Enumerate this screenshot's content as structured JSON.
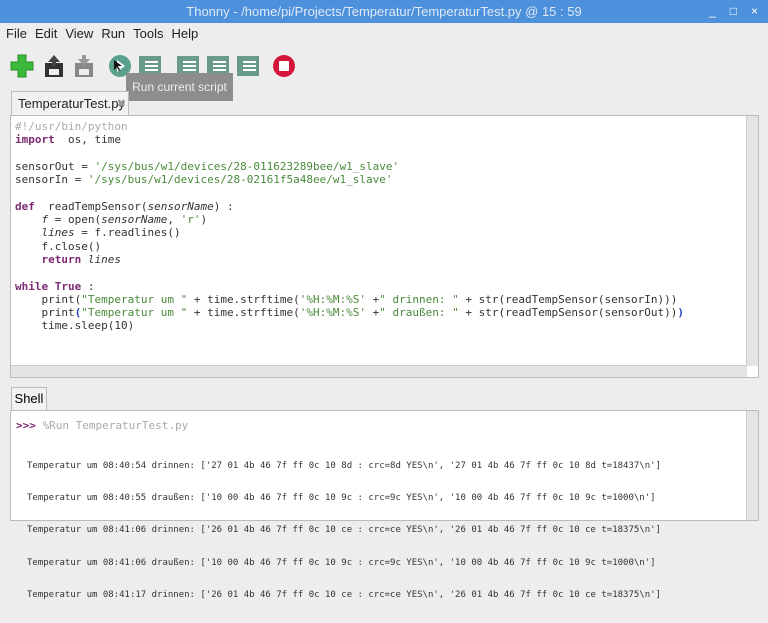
{
  "window": {
    "title": "Thonny  -  /home/pi/Projects/Temperatur/TemperaturTest.py  @  15 : 59",
    "minimize": "_",
    "maximize": "□",
    "close": "×"
  },
  "menu": [
    "File",
    "Edit",
    "View",
    "Run",
    "Tools",
    "Help"
  ],
  "toolbar": {
    "icons": [
      "new-file-icon",
      "load-icon",
      "save-icon",
      "run-icon",
      "debug-icon",
      "step-over-icon",
      "step-into-icon",
      "step-out-icon",
      "stop-icon"
    ],
    "tooltip": "Run current script",
    "accent_run": "#5aa08c",
    "accent_stop": "#d6153a"
  },
  "editor": {
    "tab_label": "TemperaturTest.py",
    "tab_close": "✖",
    "lines": [
      [
        [
          "cm",
          "#!/usr/bin/python"
        ]
      ],
      [
        [
          "kw",
          "import"
        ],
        [
          "",
          "  os, time"
        ]
      ],
      [],
      [
        [
          "",
          "sensorOut = "
        ],
        [
          "str",
          "'/sys/bus/w1/devices/28-011623289bee/w1_slave'"
        ]
      ],
      [
        [
          "",
          "sensorIn = "
        ],
        [
          "str",
          "'/sys/bus/w1/devices/28-02161f5a48ee/w1_slave'"
        ]
      ],
      [],
      [
        [
          "kw",
          "def"
        ],
        [
          "",
          "  readTempSensor("
        ],
        [
          "it",
          "sensorName"
        ],
        [
          "",
          ") :"
        ]
      ],
      [
        [
          "",
          "    "
        ],
        [
          "it",
          "f"
        ],
        [
          "",
          "",
          " = open("
        ],
        [
          "it",
          "sensorName"
        ],
        [
          "",
          ", "
        ],
        [
          "str",
          "'r'"
        ],
        [
          "",
          ")"
        ]
      ],
      [
        [
          "",
          "    "
        ],
        [
          "it",
          "lines"
        ],
        [
          "",
          "",
          " = f.readlines()"
        ]
      ],
      [
        [
          "",
          "    f.close()"
        ]
      ],
      [
        [
          "",
          "    "
        ],
        [
          "kw",
          "return"
        ],
        [
          "",
          "",
          " "
        ],
        [
          "it",
          "lines"
        ]
      ],
      [],
      [
        [
          "kw",
          "while True"
        ],
        [
          "",
          "",
          " :"
        ]
      ],
      [
        [
          "",
          "    print("
        ],
        [
          "str",
          "\"Temperatur um \""
        ],
        [
          "",
          "",
          " + time.strftime("
        ],
        [
          "str",
          "'%H:%M:%S'"
        ],
        [
          "",
          "",
          " +"
        ],
        [
          "str",
          "\" drinnen: \""
        ],
        [
          "",
          "",
          " + str(readTempSensor(sensorIn)))"
        ]
      ],
      [
        [
          "",
          "    print"
        ],
        [
          "br",
          "("
        ],
        [
          "str",
          "\"Temperatur um \""
        ],
        [
          "",
          "",
          " + time.strftime("
        ],
        [
          "str",
          "'%H:%M:%S'"
        ],
        [
          "",
          "",
          " +"
        ],
        [
          "str",
          "\" draußen: \""
        ],
        [
          "",
          "",
          " + str(readTempSensor(sensorOut))"
        ],
        [
          "br",
          ")"
        ]
      ],
      [
        [
          "",
          "    time.sleep(10)"
        ]
      ]
    ]
  },
  "shell": {
    "tab_label": "Shell",
    "prompt": ">>>",
    "command": " %Run TemperaturTest.py",
    "output": [
      "Temperatur um 08:40:54 drinnen: ['27 01 4b 46 7f ff 0c 10 8d : crc=8d YES\\n', '27 01 4b 46 7f ff 0c 10 8d t=18437\\n']",
      "Temperatur um 08:40:55 draußen: ['10 00 4b 46 7f ff 0c 10 9c : crc=9c YES\\n', '10 00 4b 46 7f ff 0c 10 9c t=1000\\n']",
      "Temperatur um 08:41:06 drinnen: ['26 01 4b 46 7f ff 0c 10 ce : crc=ce YES\\n', '26 01 4b 46 7f ff 0c 10 ce t=18375\\n']",
      "Temperatur um 08:41:06 draußen: ['10 00 4b 46 7f ff 0c 10 9c : crc=9c YES\\n', '10 00 4b 46 7f ff 0c 10 9c t=1000\\n']",
      "Temperatur um 08:41:17 drinnen: ['26 01 4b 46 7f ff 0c 10 ce : crc=ce YES\\n', '26 01 4b 46 7f ff 0c 10 ce t=18375\\n']"
    ]
  }
}
